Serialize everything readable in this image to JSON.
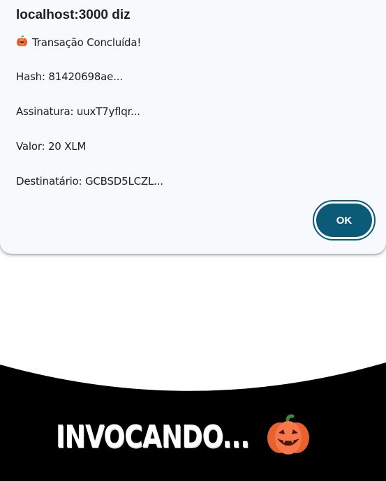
{
  "dialog": {
    "title": "localhost:3000 diz",
    "lines": [
      "Transação Concluída!",
      "Hash: 81420698ae...",
      "Assinatura: uuxT7yflqr...",
      "Valor: 20 XLM",
      "Destinatário: GCBSD5LCZL..."
    ],
    "ok_label": "OK"
  },
  "banner": {
    "text": "INVOCANDO..."
  },
  "icons": {
    "dialog_icon": "pumpkin-icon",
    "banner_icon": "pumpkin-icon"
  },
  "colors": {
    "ok_button": "#0b5a78",
    "dialog_bg": "#f8f9fc",
    "banner_bg": "#000000",
    "pumpkin": "#f26b3a"
  }
}
